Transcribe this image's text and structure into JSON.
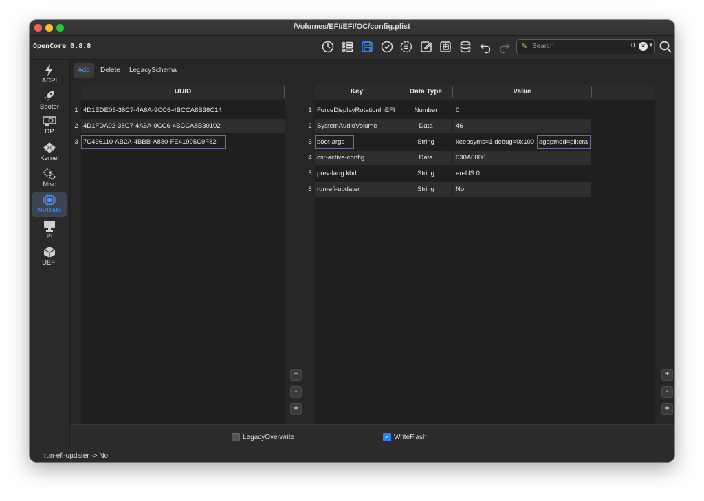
{
  "window": {
    "title": "/Volumes/EFI/EFI/OC/config.plist"
  },
  "toolbar": {
    "app_version": "OpenCore 0.8.8",
    "search": {
      "placeholder": "Search",
      "count": "0"
    },
    "icons": [
      "history-icon",
      "list-icon",
      "save-icon",
      "checkmark-icon",
      "clipboard-list-icon",
      "edit-document-icon",
      "import-icon",
      "database-icon",
      "undo-icon",
      "redo-icon"
    ]
  },
  "sidebar": {
    "items": [
      {
        "label": "ACPI",
        "icon": "lightning-icon"
      },
      {
        "label": "Booter",
        "icon": "rocket-icon"
      },
      {
        "label": "DP",
        "icon": "gpu-card-icon"
      },
      {
        "label": "Kernel",
        "icon": "puzzle-icon"
      },
      {
        "label": "Misc",
        "icon": "gears-icon"
      },
      {
        "label": "NVRAM",
        "icon": "chip-icon"
      },
      {
        "label": "PI",
        "icon": "monitor-icon"
      },
      {
        "label": "UEFI",
        "icon": "cube-icon"
      }
    ],
    "active": "NVRAM",
    "accent": "#4b8dff"
  },
  "tabs": [
    {
      "label": "Add",
      "active": true
    },
    {
      "label": "Delete",
      "active": false
    },
    {
      "label": "LegacySchema",
      "active": false
    }
  ],
  "uuid_table": {
    "header": "UUID",
    "rows": [
      {
        "num": "1",
        "value": "4D1EDE05-38C7-4A6A-9CC6-4BCCA8B38C14"
      },
      {
        "num": "2",
        "value": "4D1FDA02-38C7-4A6A-9CC6-4BCCA8B30102"
      },
      {
        "num": "3",
        "value": "7C436110-AB2A-4BBB-A880-FE41995C9F82"
      }
    ],
    "selected_row": 3
  },
  "kv_table": {
    "headers": {
      "key": "Key",
      "type": "Data Type",
      "value": "Value"
    },
    "rows": [
      {
        "num": "1",
        "key": "ForceDisplayRotationInEFI",
        "type": "Number",
        "value": "0"
      },
      {
        "num": "2",
        "key": "SystemAudioVolume",
        "type": "Data",
        "value": "46"
      },
      {
        "num": "3",
        "key": "boot-args",
        "type": "String",
        "value": "keepsyms=1 debug=0x100",
        "value_extra": "agdpmod=pikera"
      },
      {
        "num": "4",
        "key": "csr-active-config",
        "type": "Data",
        "value": "030A0000"
      },
      {
        "num": "5",
        "key": "prev-lang:kbd",
        "type": "String",
        "value": "en-US:0"
      },
      {
        "num": "6",
        "key": "run-efi-updater",
        "type": "String",
        "value": "No"
      }
    ],
    "selected_row": 3
  },
  "side_buttons": {
    "add": "+",
    "remove": "-",
    "equal": "="
  },
  "bottom": {
    "legacy_overwrite": {
      "label": "LegacyOverwrite",
      "checked": false
    },
    "write_flash": {
      "label": "WriteFlash",
      "checked": true
    }
  },
  "status": {
    "text": "run-efi-updater -> No"
  }
}
